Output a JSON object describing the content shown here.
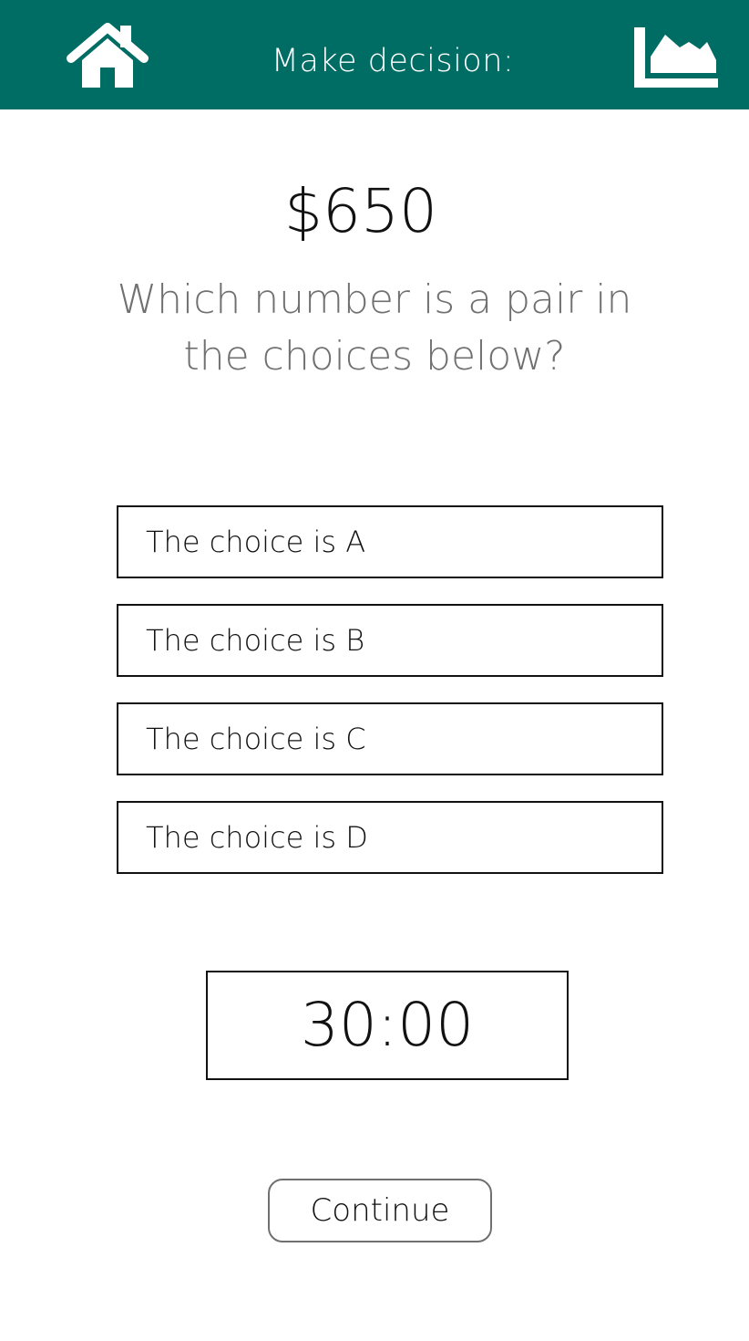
{
  "header": {
    "title": "Make decision:",
    "background_color": "#006d65",
    "home_icon": "home-icon",
    "chart_icon": "area-chart-icon"
  },
  "prize": {
    "amount": "$650"
  },
  "question": {
    "text": "Which number is a pair in the choices below?"
  },
  "choices": [
    {
      "label": "The choice is A"
    },
    {
      "label": "The choice is B"
    },
    {
      "label": "The choice is C"
    },
    {
      "label": "The choice is D"
    }
  ],
  "timer": {
    "value": "30:00"
  },
  "actions": {
    "continue_label": "Continue"
  }
}
